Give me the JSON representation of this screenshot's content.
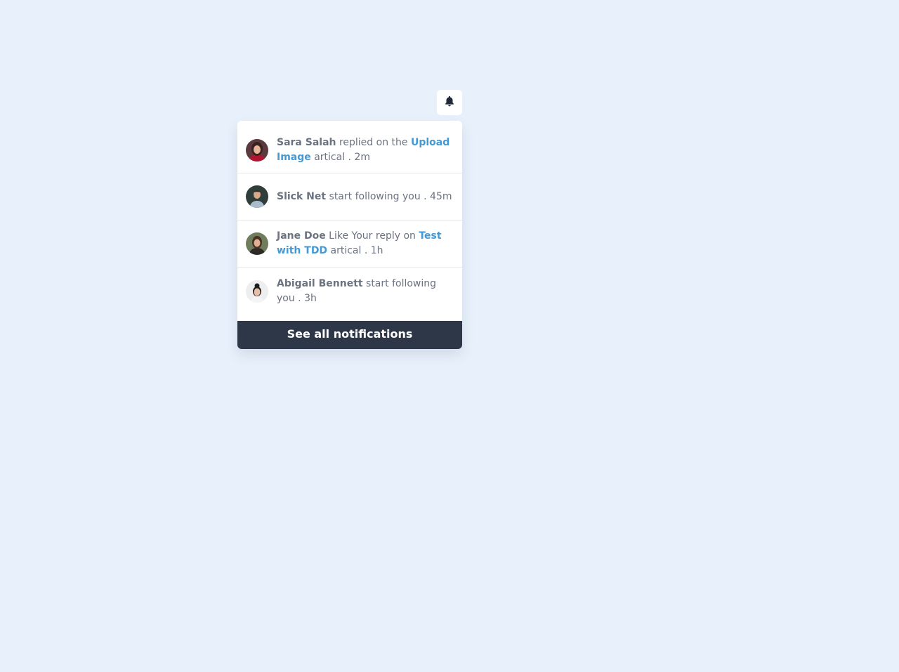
{
  "bell": {
    "icon": "bell-icon"
  },
  "notifications": [
    {
      "name": "Sara Salah",
      "action": " replied on the ",
      "link": "Upload Image",
      "suffix": " artical . 2m",
      "avatar": "avatar-sara"
    },
    {
      "name": "Slick Net",
      "action": " start following you . 45m",
      "link": "",
      "suffix": "",
      "avatar": "avatar-slick"
    },
    {
      "name": "Jane Doe",
      "action": " Like Your reply on ",
      "link": "Test with TDD",
      "suffix": " artical . 1h",
      "avatar": "avatar-jane"
    },
    {
      "name": "Abigail Bennett",
      "action": " start following you . 3h",
      "link": "",
      "suffix": "",
      "avatar": "avatar-abigail"
    }
  ],
  "footer": {
    "see_all_label": "See all notifications"
  },
  "colors": {
    "background": "#e8f1fb",
    "link": "#4299d6",
    "footer": "#2d3748",
    "text": "#6b7280"
  }
}
